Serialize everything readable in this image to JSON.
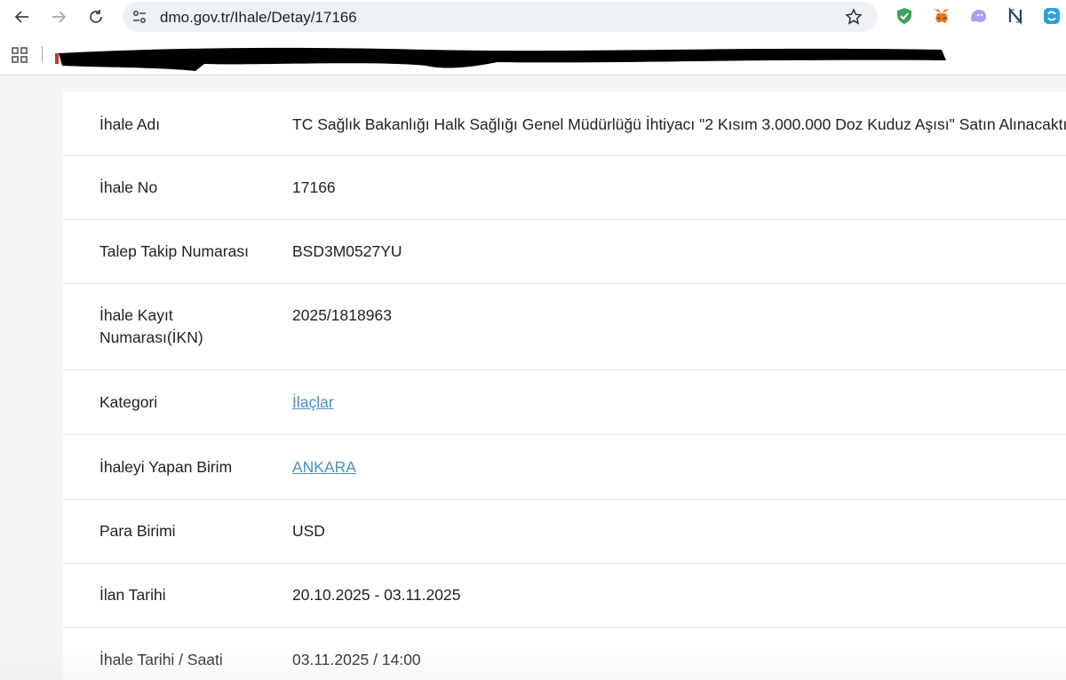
{
  "browser": {
    "url": "dmo.gov.tr/Ihale/Detay/17166",
    "extensions": [
      "shield-extension-icon",
      "metamask-fox-icon",
      "ghost-wallet-icon",
      "n-logo-extension-icon",
      "sync-extension-icon"
    ]
  },
  "details": {
    "rows": [
      {
        "label": "İhale Adı",
        "value": "TC Sağlık Bakanlığı Halk Sağlığı Genel Müdürlüğü İhtiyacı \"2 Kısım 3.000.000 Doz Kuduz Aşısı\" Satın Alınacaktır",
        "link": false
      },
      {
        "label": "İhale No",
        "value": "17166",
        "link": false
      },
      {
        "label": "Talep Takip Numarası",
        "value": "BSD3M0527YU",
        "link": false
      },
      {
        "label": "İhale Kayıt Numarası(İKN)",
        "value": "2025/1818963",
        "link": false
      },
      {
        "label": "Kategori",
        "value": "İlaçlar",
        "link": true
      },
      {
        "label": "İhaleyi Yapan Birim",
        "value": "ANKARA",
        "link": true
      },
      {
        "label": "Para Birimi",
        "value": "USD",
        "link": false
      },
      {
        "label": "İlan Tarihi",
        "value": "20.10.2025 - 03.11.2025",
        "link": false
      },
      {
        "label": "İhale Tarihi / Saati",
        "value": "03.11.2025 / 14:00",
        "link": false
      }
    ]
  },
  "colors": {
    "link": "#4a8fc6",
    "background": "#f5f5f6",
    "card": "#ffffff"
  }
}
